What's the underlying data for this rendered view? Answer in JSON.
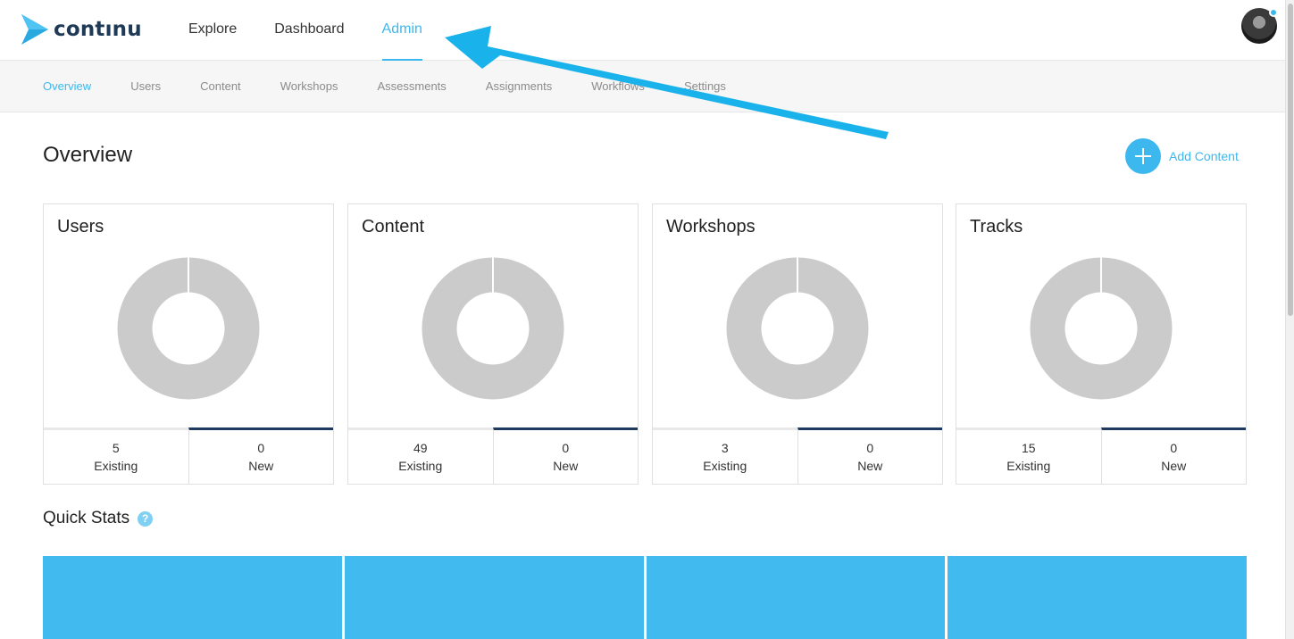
{
  "app": {
    "logo_text": "contınu"
  },
  "topnav": {
    "items": [
      {
        "label": "Explore",
        "active": false
      },
      {
        "label": "Dashboard",
        "active": false
      },
      {
        "label": "Admin",
        "active": true
      }
    ]
  },
  "subnav": {
    "items": [
      {
        "label": "Overview",
        "active": true
      },
      {
        "label": "Users",
        "active": false
      },
      {
        "label": "Content",
        "active": false
      },
      {
        "label": "Workshops",
        "active": false
      },
      {
        "label": "Assessments",
        "active": false
      },
      {
        "label": "Assignments",
        "active": false
      },
      {
        "label": "Workflows",
        "active": false
      },
      {
        "label": "Settings",
        "active": false
      }
    ]
  },
  "page": {
    "title": "Overview",
    "add_content_label": "Add Content"
  },
  "cards": [
    {
      "title": "Users",
      "existing": "5",
      "existing_label": "Existing",
      "new": "0",
      "new_label": "New"
    },
    {
      "title": "Content",
      "existing": "49",
      "existing_label": "Existing",
      "new": "0",
      "new_label": "New"
    },
    {
      "title": "Workshops",
      "existing": "3",
      "existing_label": "Existing",
      "new": "0",
      "new_label": "New"
    },
    {
      "title": "Tracks",
      "existing": "15",
      "existing_label": "Existing",
      "new": "0",
      "new_label": "New"
    }
  ],
  "quick_stats": {
    "title": "Quick Stats",
    "help_glyph": "?"
  },
  "colors": {
    "accent": "#3db8ef",
    "navy": "#1e3a5e",
    "donut_gray": "#cbcbcb",
    "quick_stat_tile": "#40baef",
    "annotation_arrow": "#1ab2ea"
  },
  "icons": {
    "logo": "continu-chevron-logo",
    "add": "plus-circle-icon",
    "help": "question-circle-icon",
    "avatar": "user-avatar"
  }
}
